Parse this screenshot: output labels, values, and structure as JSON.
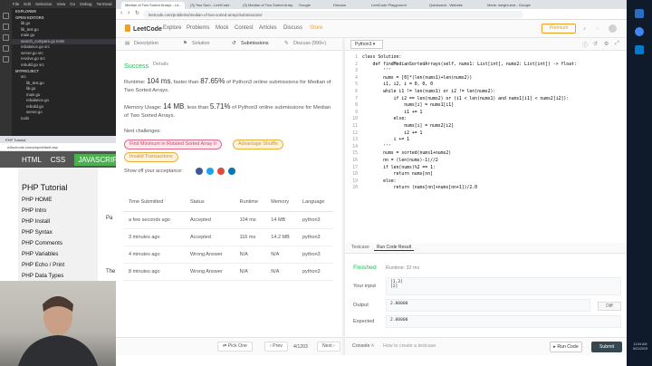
{
  "vscode": {
    "menu": [
      "File",
      "Edit",
      "Selection",
      "View",
      "Go",
      "Debug",
      "Terminal"
    ],
    "explorer_label": "EXPLORER",
    "open_editors_label": "OPEN EDITORS",
    "open_editors": [
      "lib.go",
      "lib_test.go",
      "main.go",
      "search_compare.go  tests",
      "rebalance.go  src",
      "server.go  src",
      "resolve.go  src",
      "rebuild.go  src"
    ],
    "project_label": "MYPROJECT",
    "tree": [
      "src",
      "lib_test.go",
      "lib.go",
      "main.go",
      "rebalance.go",
      "rebuild.go",
      "server.go",
      "tools"
    ]
  },
  "w3": {
    "tab": "PHP Tutorial",
    "url": "w3schools.com/php/default.asp",
    "nav": [
      "HTML",
      "CSS",
      "JAVASCRIPT"
    ],
    "title": "PHP Tutorial",
    "links": [
      "PHP HOME",
      "PHP Intro",
      "PHP Install",
      "PHP Syntax",
      "PHP Comments",
      "PHP Variables",
      "PHP Echo / Print",
      "PHP Data Types"
    ],
    "main_snips": [
      "Pa",
      "The"
    ]
  },
  "browser": {
    "tabs": [
      "Median of Two Sorted Arrays - Le...",
      "(3) Two Sum - LeetCode",
      "(3) Median of Two Sorted Array",
      "Google",
      "Discuss",
      "LeetCode Playground",
      "Quicksand - Website",
      "Meds: weight-test - Google"
    ],
    "url": "leetcode.com/problems/median-of-two-sorted-arrays/submissions/"
  },
  "leetcode": {
    "logo": "LeetCode",
    "nav": [
      "Explore",
      "Problems",
      "Mock",
      "Contest",
      "Articles",
      "Discuss",
      "Store"
    ],
    "premium": "Premium",
    "panel_tabs": [
      "Description",
      "Solution",
      "Submissions",
      "Discuss (999+)"
    ],
    "result": {
      "status": "Success",
      "details": "Details",
      "runtime_prefix": "Runtime: ",
      "runtime": "104 ms",
      "runtime_mid": ", faster than ",
      "runtime_pct": "87.65%",
      "runtime_suffix": " of Python3 online submissions for Median of Two Sorted Arrays.",
      "memory_prefix": "Memory Usage: ",
      "memory": "14 MB",
      "memory_mid": ", less than ",
      "memory_pct": "5.71%",
      "memory_suffix": " of Python3 online submissions for Median of Two Sorted Arrays."
    },
    "next_label": "Next challenges:",
    "challenges": [
      "Find Minimum in Rotated Sorted Array II",
      "Advantage Shuffle",
      "Invalid Transactions"
    ],
    "showoff": "Show off your acceptance:",
    "table": {
      "headers": [
        "Time Submitted",
        "Status",
        "Runtime",
        "Memory",
        "Language"
      ],
      "rows": [
        [
          "a few seconds ago",
          "Accepted",
          "104 ms",
          "14 MB",
          "python3"
        ],
        [
          "3 minutes ago",
          "Accepted",
          "116 ms",
          "14.2 MB",
          "python3"
        ],
        [
          "4 minutes ago",
          "Wrong Answer",
          "N/A",
          "N/A",
          "python3"
        ],
        [
          "8 minutes ago",
          "Wrong Answer",
          "N/A",
          "N/A",
          "python3"
        ]
      ]
    },
    "pager": {
      "pick": "Pick One",
      "prev": "Prev",
      "page": "4/1203",
      "next": "Next"
    },
    "editor": {
      "language": "Python3",
      "lines": [
        {
          "n": "1",
          "t": "class Solution:"
        },
        {
          "n": "2",
          "t": "    def findMedianSortedArrays(self, nums1: List[int], nums2: List[int]) -> float:"
        },
        {
          "n": "3",
          "t": "        '''"
        },
        {
          "n": "4",
          "t": "        nums = [0]*(len(nums1)+len(nums2))"
        },
        {
          "n": "5",
          "t": "        i1, i2, i = 0, 0, 0"
        },
        {
          "n": "6",
          "t": "        while i1 != len(nums1) or i2 != len(nums2):"
        },
        {
          "n": "7",
          "t": "            if i2 == len(nums2) or (i1 < len(nums1) and nums1[i1] < nums2[i2]):"
        },
        {
          "n": "8",
          "t": "                nums[i] = nums1[i1]"
        },
        {
          "n": "9",
          "t": "                i1 += 1"
        },
        {
          "n": "10",
          "t": "            else:"
        },
        {
          "n": "11",
          "t": "                nums[i] = nums2[i2]"
        },
        {
          "n": "12",
          "t": "                i2 += 1"
        },
        {
          "n": "13",
          "t": "            i += 1"
        },
        {
          "n": "14",
          "t": "        '''"
        },
        {
          "n": "15",
          "t": "        nums = sorted(nums1+nums2)"
        },
        {
          "n": "16",
          "t": "        nn = (len(nums)-1)//2"
        },
        {
          "n": "17",
          "t": "        if len(nums)%2 == 1:"
        },
        {
          "n": "18",
          "t": "            return nums[nn]"
        },
        {
          "n": "19",
          "t": "        else:"
        },
        {
          "n": "20",
          "t": "            return (nums[nn]+nums[nn+1])/2.0"
        }
      ]
    },
    "console": {
      "tabs": [
        "Testcase",
        "Run Code Result"
      ],
      "status": "Finished",
      "runtime": "Runtime: 32 ms",
      "input_label": "Your input",
      "input_lines": [
        "[1,3]",
        "[2]"
      ],
      "output_label": "Output",
      "output": "2.00000",
      "expected_label": "Expected",
      "expected": "2.00000",
      "diff": "Diff"
    },
    "bottom": {
      "console": "Console",
      "howto": "How to create a testcase",
      "run": "Run Code",
      "submit": "Submit"
    }
  },
  "taskbar": {
    "time": "11:54 AM",
    "date": "6/21/2019"
  },
  "colors": {
    "accepted": "#2db55d",
    "wrong": "#c0392b",
    "brand": "#f0a020"
  }
}
